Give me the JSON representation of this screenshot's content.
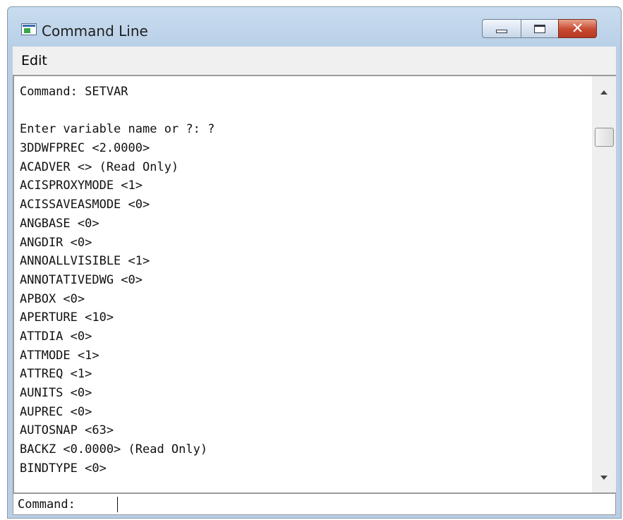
{
  "window": {
    "title": "Command Line"
  },
  "icons": {
    "app": "terminal-window-icon",
    "minimize": "minimize-icon",
    "maximize": "maximize-icon",
    "close": "close-icon",
    "scroll_up": "scroll-up-arrow-icon",
    "scroll_down": "scroll-down-arrow-icon"
  },
  "menu": {
    "items": [
      "Edit"
    ]
  },
  "history": {
    "lines": [
      "Command: SETVAR",
      "",
      "Enter variable name or ?: ?",
      "3DDWFPREC <2.0000>",
      "ACADVER <> (Read Only)",
      "ACISPROXYMODE <1>",
      "ACISSAVEASMODE <0>",
      "ANGBASE <0>",
      "ANGDIR <0>",
      "ANNOALLVISIBLE <1>",
      "ANNOTATIVEDWG <0>",
      "APBOX <0>",
      "APERTURE <10>",
      "ATTDIA <0>",
      "ATTMODE <1>",
      "ATTREQ <1>",
      "AUNITS <0>",
      "AUPREC <0>",
      "AUTOSNAP <63>",
      "BACKZ <0.0000> (Read Only)",
      "BINDTYPE <0>"
    ]
  },
  "command_input": {
    "prompt": "Command:",
    "value": ""
  },
  "colors": {
    "frame": "#b8cfe7",
    "close_button": "#c8472f",
    "menubar": "#f0f0f0"
  }
}
